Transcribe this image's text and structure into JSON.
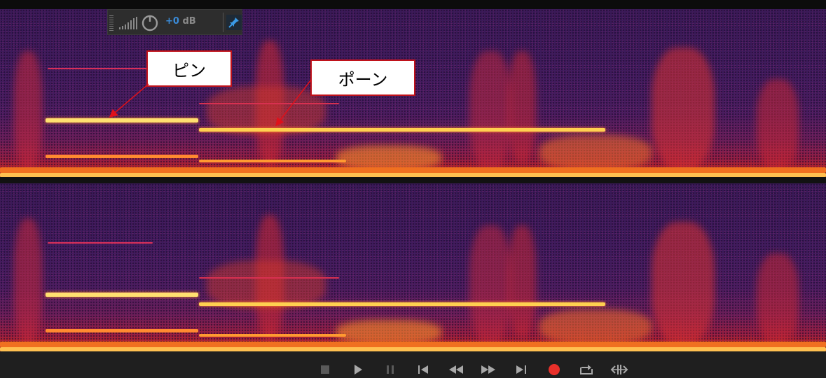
{
  "meter": {
    "gain_value": "+0",
    "gain_unit": "dB",
    "icons": [
      "grip-icon",
      "level-bars-icon",
      "power-knob-icon",
      "pin-icon"
    ]
  },
  "annotations": {
    "pin_label": "ピン",
    "pon_label": "ポーン",
    "border_color": "#c0121a",
    "arrow_color": "#e0101a"
  },
  "spectrogram": {
    "channels": [
      "left",
      "right"
    ],
    "palette": [
      "#3a1a58",
      "#6a1e58",
      "#c8281c",
      "#e86010",
      "#ffd860"
    ]
  },
  "transport": {
    "buttons": [
      {
        "name": "stop-button",
        "icon": "stop-icon"
      },
      {
        "name": "play-button",
        "icon": "play-icon"
      },
      {
        "name": "pause-button",
        "icon": "pause-icon"
      },
      {
        "name": "move-to-start-button",
        "icon": "skip-back-icon"
      },
      {
        "name": "rewind-button",
        "icon": "rewind-icon"
      },
      {
        "name": "fast-forward-button",
        "icon": "fast-forward-icon"
      },
      {
        "name": "move-to-end-button",
        "icon": "skip-forward-icon"
      },
      {
        "name": "record-button",
        "icon": "record-icon"
      },
      {
        "name": "loop-playback-button",
        "icon": "loop-icon"
      },
      {
        "name": "skip-selection-button",
        "icon": "skip-selection-icon"
      }
    ],
    "record_color": "#e8302a",
    "icon_color": "#a8a8a8"
  }
}
